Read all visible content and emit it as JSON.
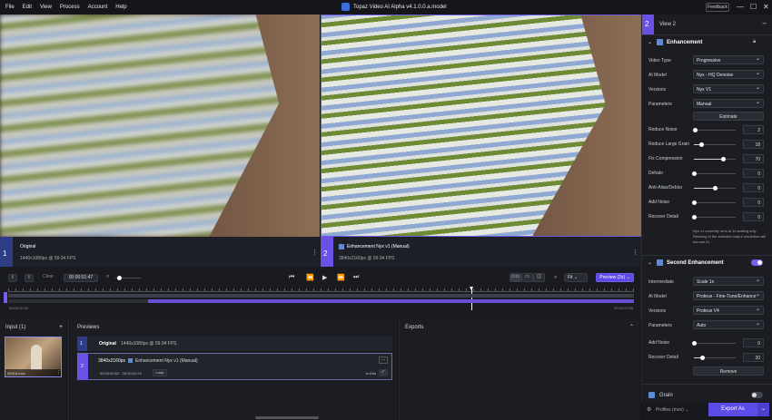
{
  "menu": [
    "File",
    "Edit",
    "View",
    "Process",
    "Account",
    "Help"
  ],
  "app_title": "Topaz Video AI Alpha  v4.1.0.0.a.model",
  "feedback": "Feedback",
  "view1": {
    "num": "1",
    "title": "Original",
    "info": "1440x1080px @ 59.94 FPS"
  },
  "view2": {
    "num": "2",
    "title": "Enhancement Nyx v1 (Manual)",
    "info": "3840x2160px @ 59.94 FPS"
  },
  "toolbar": {
    "f1": "I",
    "f2": "I",
    "clear": "Clear",
    "time": "00:00:01:47",
    "fit": "Fit",
    "preview": "Preview (2x)"
  },
  "timeline": {
    "start": "00:00:00:00",
    "end": "00:00:02:59"
  },
  "input": {
    "title": "Input (1)",
    "filename": "00016.mov"
  },
  "previews": {
    "title": "Previews",
    "r1num": "1",
    "r1title": "Original",
    "r1info": "1440x1080px @ 59.94 FPS",
    "r2num": "2",
    "r2res": "3840x2160px",
    "r2title": "Enhancement Nyx v1 (Manual)",
    "r2range": "00:00:00:52 - 00:00:02:24",
    "loop": "Loop",
    "r2time": "1m18s"
  },
  "exports": {
    "title": "Exports"
  },
  "sidebar": {
    "viewnum": "2",
    "viewtitle": "View 2",
    "enh_title": "Enhancement",
    "video_type_label": "Video Type",
    "video_type": "Progressive",
    "ai_model_label": "AI Model",
    "ai_model": "Nyx - HQ Denoise",
    "versions_label": "Versions",
    "versions": "Nyx V1",
    "parameters_label": "Parameters",
    "parameters": "Manual",
    "estimate": "Estimate",
    "sliders": [
      {
        "label": "Reduce Noise",
        "value": "2",
        "frac": 0.02
      },
      {
        "label": "Reduce Large Grain",
        "value": "18",
        "frac": 0.18
      },
      {
        "label": "Fix Compression",
        "value": "70",
        "frac": 0.7
      },
      {
        "label": "Dehalo",
        "value": "0",
        "frac": 0
      },
      {
        "label": "Anti-Alias/Deblur",
        "value": "0",
        "frac": 0.5
      },
      {
        "label": "Add Noise",
        "value": "0",
        "frac": 0
      },
      {
        "label": "Recover Detail",
        "value": "0",
        "frac": 0
      }
    ],
    "note": "Nyx v1 currently runs at 1x scaling only. Resizing to the selected output resolution will not use AI.",
    "second_title": "Second Enhancement",
    "intermediate_label": "Intermediate",
    "intermediate": "Scale 1x",
    "ai_model2_label": "AI Model",
    "ai_model2": "Proteus - Fine-Tune/Enhance",
    "versions2_label": "Versions",
    "versions2": "Proteus V4",
    "parameters2_label": "Parameters",
    "parameters2": "Auto",
    "sliders2": [
      {
        "label": "Add Noise",
        "value": "0",
        "frac": 0
      },
      {
        "label": "Recover Detail",
        "value": "20",
        "frac": 0.2
      }
    ],
    "remove": "Remove",
    "grain": "Grain",
    "profiles": "Profiles (mov)",
    "export": "Export As"
  },
  "colors": {
    "accent": "#7b5cf0",
    "blue_track": "#3e4f9c"
  }
}
